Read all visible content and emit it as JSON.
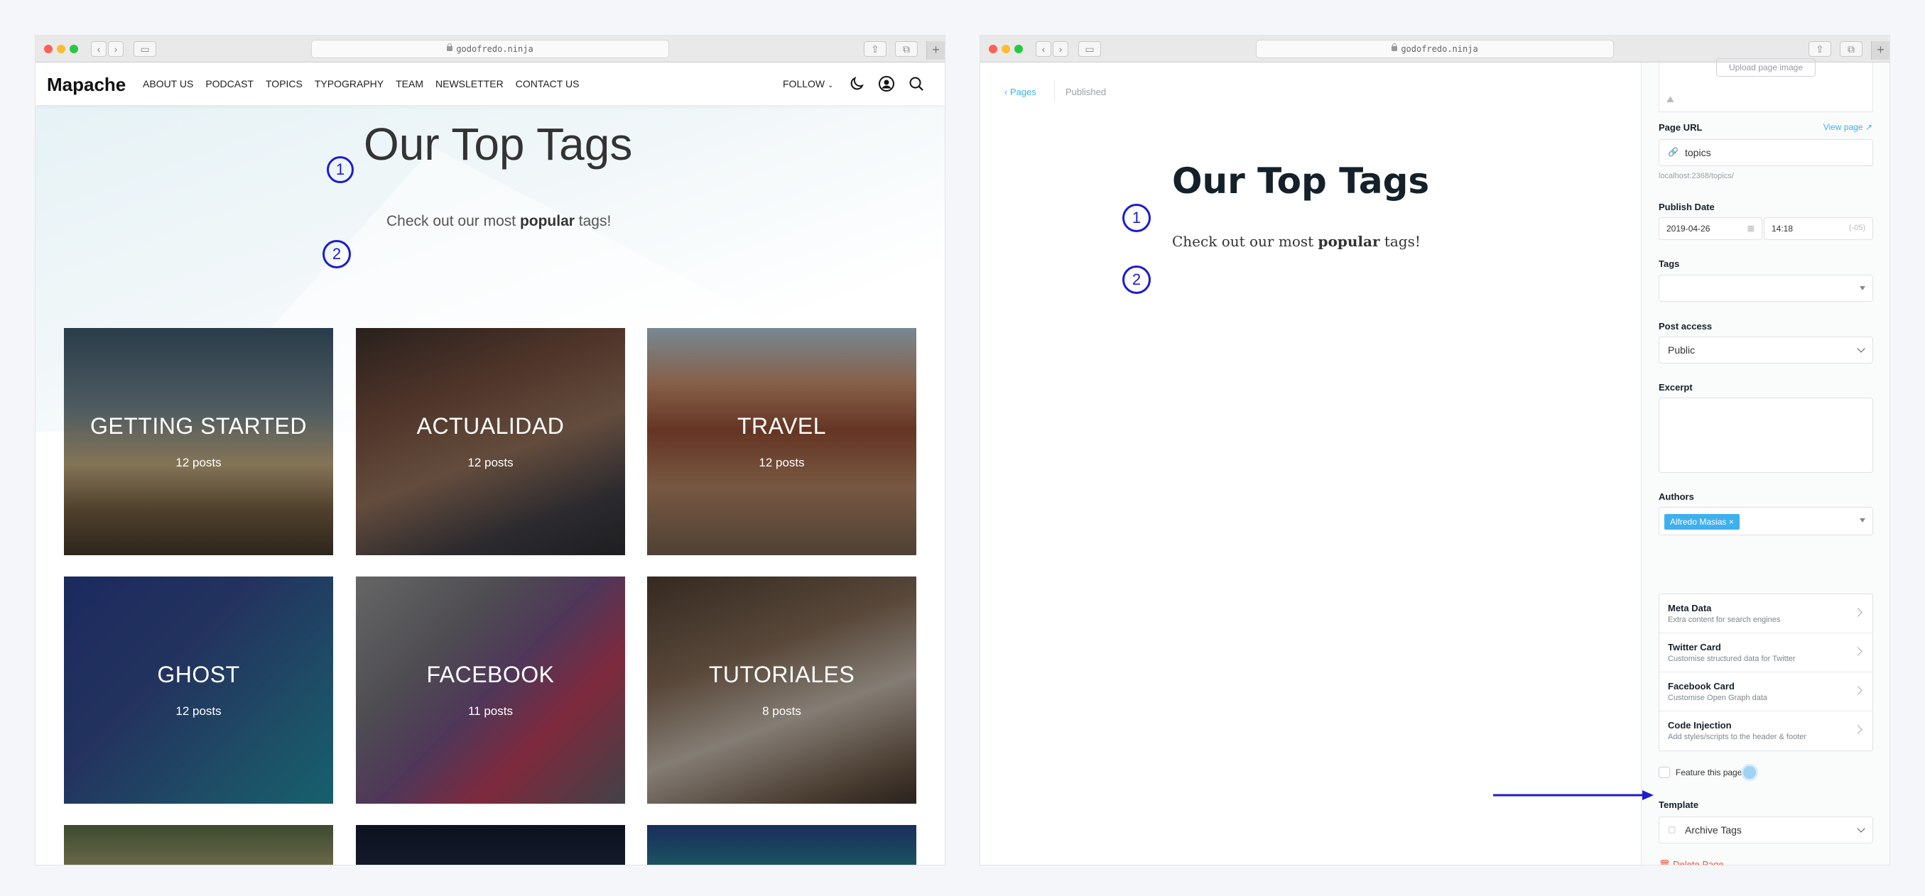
{
  "left_window": {
    "url": "godofredo.ninja",
    "site": {
      "logo": "Mapache",
      "menu": [
        "ABOUT US",
        "PODCAST",
        "TOPICS",
        "TYPOGRAPHY",
        "TEAM",
        "NEWSLETTER",
        "CONTACT US"
      ],
      "follow": "FOLLOW",
      "title": "Our Top Tags",
      "subtitle_pre": "Check out our most",
      "subtitle_bold": "popular",
      "subtitle_post": "tags!",
      "cards": [
        {
          "title": "GETTING STARTED",
          "count": "12 posts"
        },
        {
          "title": "ACTUALIDAD",
          "count": "12 posts"
        },
        {
          "title": "TRAVEL",
          "count": "12 posts"
        },
        {
          "title": "GHOST",
          "count": "12 posts"
        },
        {
          "title": "FACEBOOK",
          "count": "11 posts"
        },
        {
          "title": "TUTORIALES",
          "count": "8 posts"
        }
      ]
    }
  },
  "right_window": {
    "url": "godofredo.ninja",
    "breadcrumb": {
      "pages": "Pages",
      "status": "Published"
    },
    "editor": {
      "title": "Our Top Tags",
      "subtitle_pre": "Check out our most",
      "subtitle_bold": "popular",
      "subtitle_post": "tags!"
    },
    "sidebar": {
      "upload_label": "Upload page image",
      "page_url_label": "Page URL",
      "view_page": "View page",
      "slug": "topics",
      "full_url": "localhost:2368/topics/",
      "publish_date_label": "Publish Date",
      "date": "2019-04-26",
      "time": "14:18",
      "tz": "(-05)",
      "tags_label": "Tags",
      "post_access_label": "Post access",
      "post_access_value": "Public",
      "excerpt_label": "Excerpt",
      "authors_label": "Authors",
      "author": "Alfredo Masias",
      "groups": [
        {
          "title": "Meta Data",
          "desc": "Extra content for search engines"
        },
        {
          "title": "Twitter Card",
          "desc": "Customise structured data for Twitter"
        },
        {
          "title": "Facebook Card",
          "desc": "Customise Open Graph data"
        },
        {
          "title": "Code Injection",
          "desc": "Add styles/scripts to the header & footer"
        }
      ],
      "feature_label": "Feature this page",
      "template_label": "Template",
      "template_value": "Archive Tags",
      "delete_label": "Delete Page"
    }
  },
  "annotations": {
    "one": "1",
    "two": "2"
  },
  "colors": {
    "annotation": "#1c1ccf",
    "ghost_blue": "#3eb0ef",
    "delete_red": "#f05230"
  }
}
